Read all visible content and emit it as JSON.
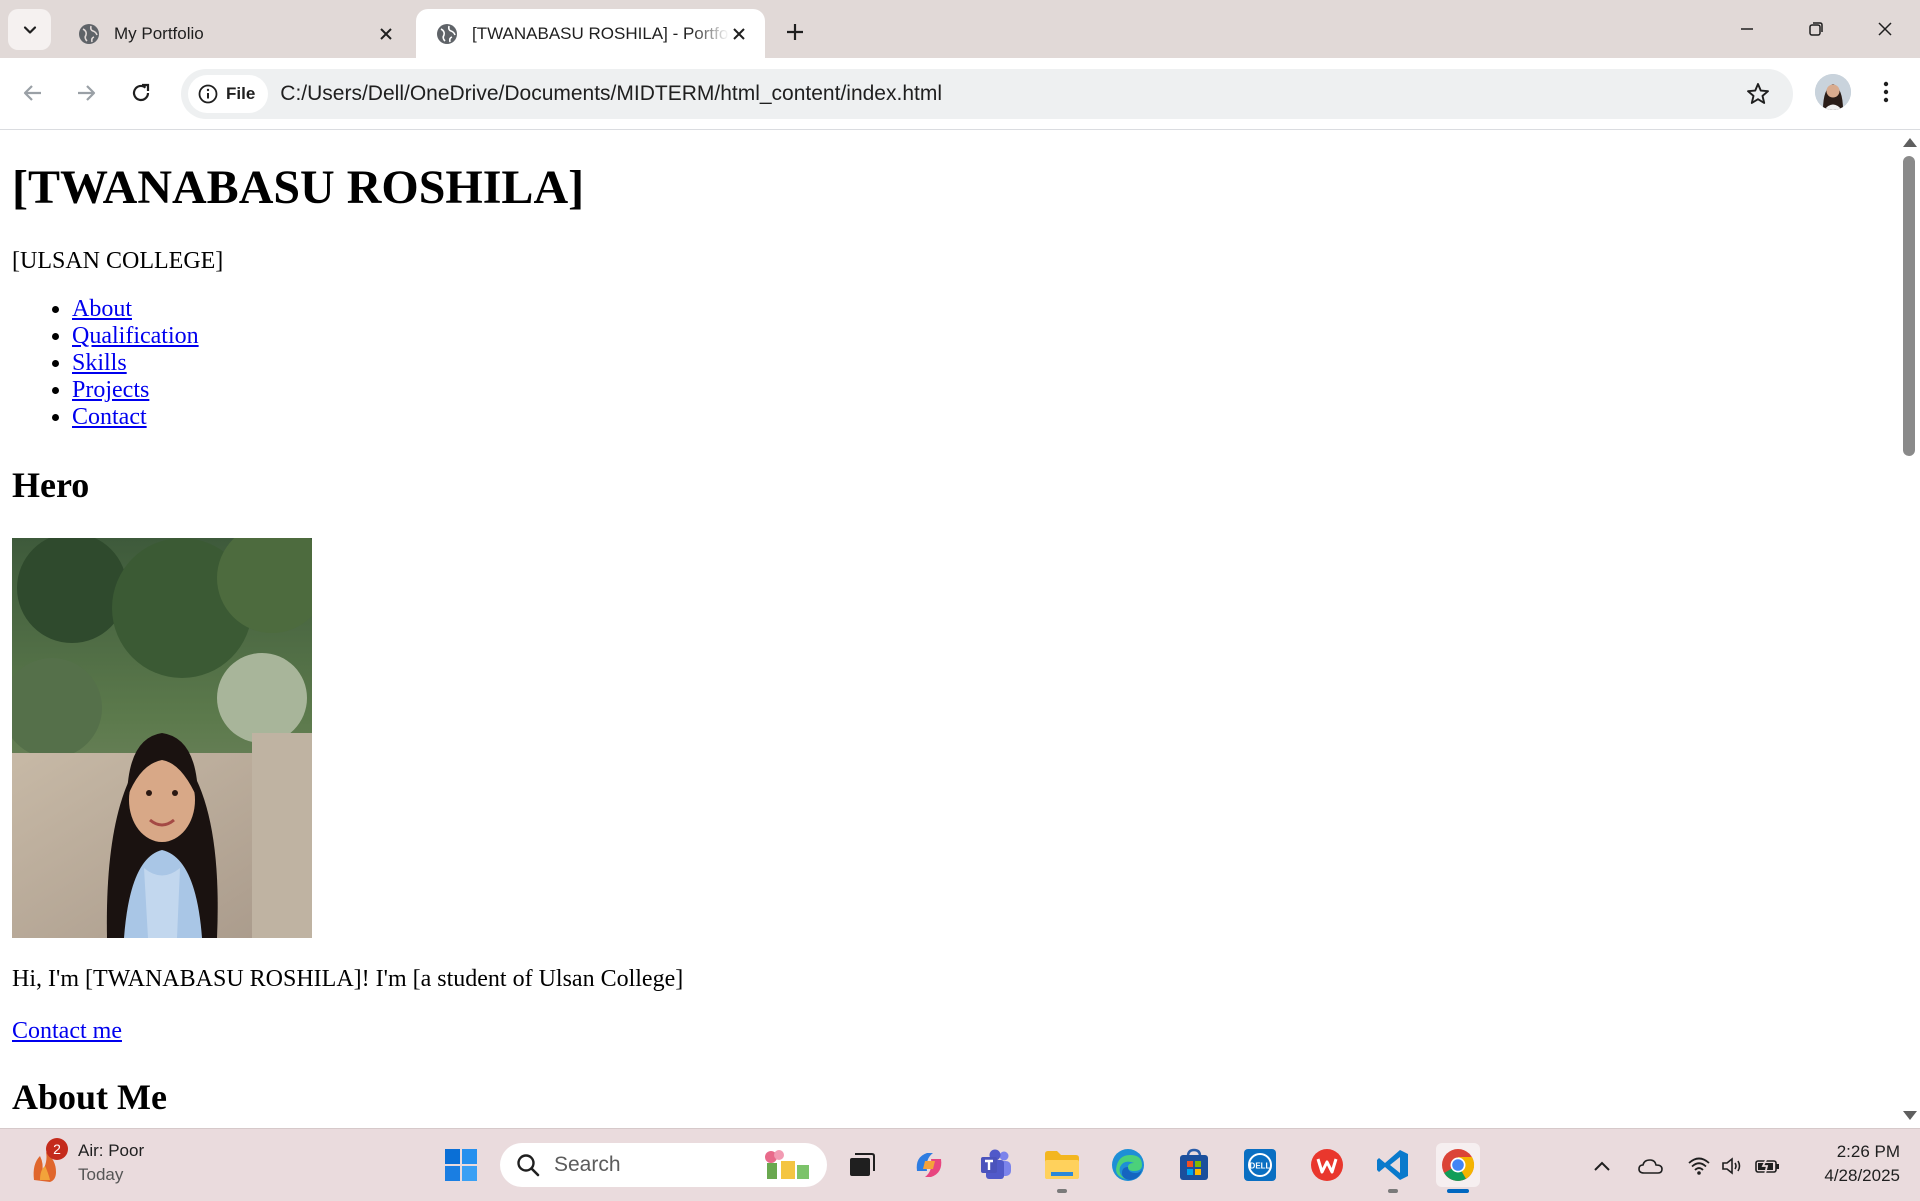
{
  "browser": {
    "tabs": [
      {
        "title": "My Portfolio",
        "active": false
      },
      {
        "title": "[TWANABASU ROSHILA] - Portfolio",
        "active": true
      }
    ],
    "address": {
      "chip_label": "File",
      "url": "C:/Users/Dell/OneDrive/Documents/MIDTERM/html_content/index.html"
    }
  },
  "page": {
    "name": "[TWANABASU ROSHILA]",
    "school": "[ULSAN COLLEGE]",
    "nav": [
      "About",
      "Qualification",
      "Skills",
      "Projects",
      "Contact"
    ],
    "hero_heading": "Hero",
    "intro": "Hi, I'm [TWANABASU ROSHILA]! I'm [a student of Ulsan College]",
    "contact_link": "Contact me",
    "about_heading": "About Me"
  },
  "taskbar": {
    "weather": {
      "badge": "2",
      "title": "Air: Poor",
      "subtitle": "Today"
    },
    "search_placeholder": "Search",
    "clock": {
      "time": "2:26 PM",
      "date": "4/28/2025"
    }
  },
  "colors": {
    "link": "#0000ee",
    "tabstrip": "#e1d9d7",
    "taskbar": "#eadbdd",
    "accent": "#0067c0"
  }
}
